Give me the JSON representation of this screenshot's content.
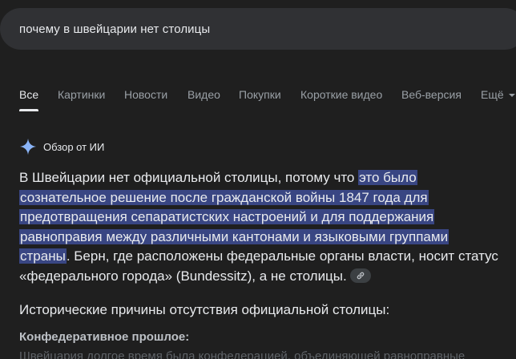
{
  "search": {
    "query": "почему в швейцарии нет столицы"
  },
  "tabs": [
    {
      "label": "Все",
      "active": true
    },
    {
      "label": "Картинки"
    },
    {
      "label": "Новости"
    },
    {
      "label": "Видео"
    },
    {
      "label": "Покупки"
    },
    {
      "label": "Короткие видео"
    },
    {
      "label": "Веб-версия"
    },
    {
      "label": "Ещё"
    }
  ],
  "ai_overview": {
    "icon": "sparkle-icon",
    "title": "Обзор от ИИ",
    "answer_plain_start": "В Швейцарии нет официальной столицы, потому что ",
    "answer_highlight_1": "это было",
    "answer_highlight_2": "сознательное решение после гражданской войны 1847 года для",
    "answer_highlight_3": "предотвращения сепаратистских настроений и для поддержания",
    "answer_highlight_4": "равноправия между различными кантонами и языковыми группами",
    "answer_highlight_5": "страны",
    "answer_plain_end": ". Берн, где расположены федеральные органы власти, носит статус «федерального города» (Bundessitz), а не столицы.",
    "link_icon": "link-icon",
    "section_heading": "Исторические причины отсутствия официальной столицы:",
    "sub_heading": "Конфедеративное прошлое:",
    "faded_text": "Швейцария долгое время была конфедерацией, объединяющей равноправные"
  },
  "colors": {
    "background": "#1f1f1f",
    "search_bar": "#303134",
    "highlight": "#394683",
    "sparkle": "#8ab4f8"
  }
}
